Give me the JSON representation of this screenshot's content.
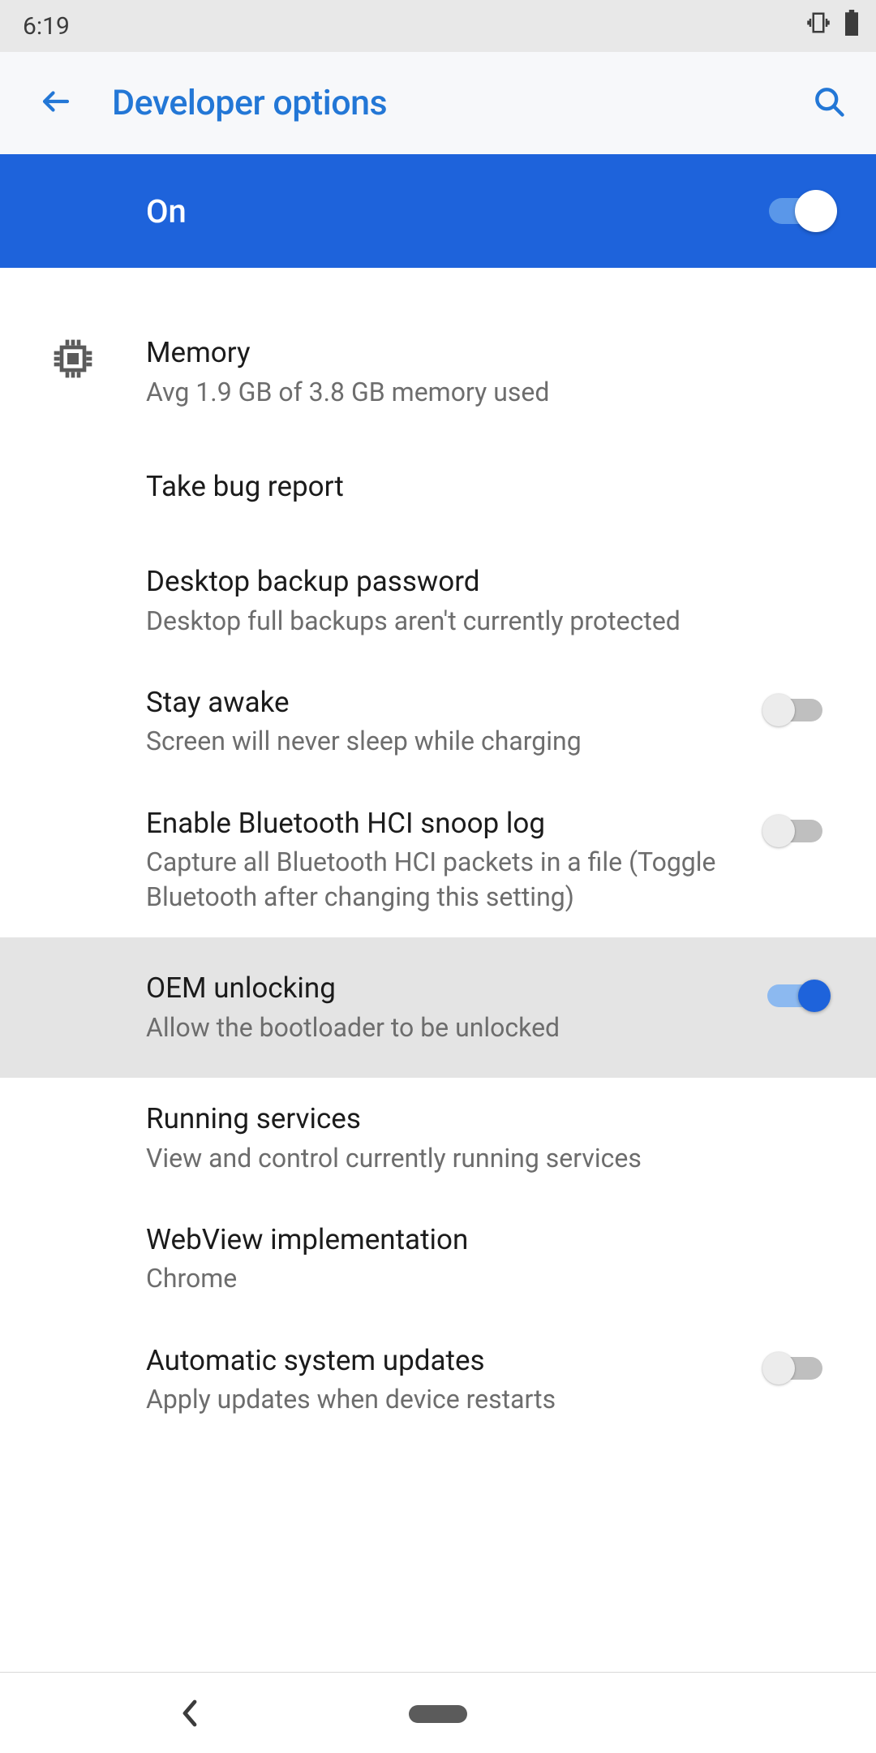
{
  "status": {
    "time": "6:19"
  },
  "appbar": {
    "title": "Developer options"
  },
  "hero": {
    "label": "On",
    "enabled": true
  },
  "items": [
    {
      "title": "Memory",
      "sub": "Avg 1.9 GB of 3.8 GB memory used",
      "icon": "chip",
      "switch": null
    },
    {
      "title": "Take bug report",
      "sub": "",
      "switch": null
    },
    {
      "title": "Desktop backup password",
      "sub": "Desktop full backups aren't currently protected",
      "switch": null
    },
    {
      "title": "Stay awake",
      "sub": "Screen will never sleep while charging",
      "switch": false
    },
    {
      "title": "Enable Bluetooth HCI snoop log",
      "sub": "Capture all Bluetooth HCI packets in a file (Toggle Bluetooth after changing this setting)",
      "switch": false
    },
    {
      "title": "OEM unlocking",
      "sub": "Allow the bootloader to be unlocked",
      "switch": true,
      "highlight": true
    },
    {
      "title": "Running services",
      "sub": "View and control currently running services",
      "switch": null
    },
    {
      "title": "WebView implementation",
      "sub": "Chrome",
      "switch": null
    },
    {
      "title": "Automatic system updates",
      "sub": "Apply updates when device restarts",
      "switch": false
    }
  ]
}
